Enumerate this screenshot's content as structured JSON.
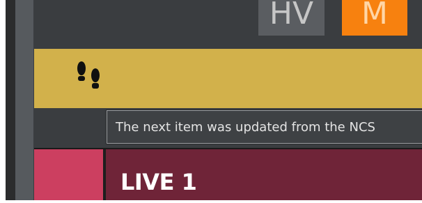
{
  "toolbar": {
    "hv_label": "HV",
    "m_label": "M"
  },
  "tooltip": {
    "text": "The next item was updated from the NCS"
  },
  "rundown_item": {
    "label": "LIVE 1"
  },
  "colors": {
    "gold_band": "#d2b14b",
    "m_button": "#f7810f",
    "live_swatch": "#cc3f60",
    "live_row": "#6f2438"
  },
  "icons": {
    "status": "footprints-icon"
  }
}
